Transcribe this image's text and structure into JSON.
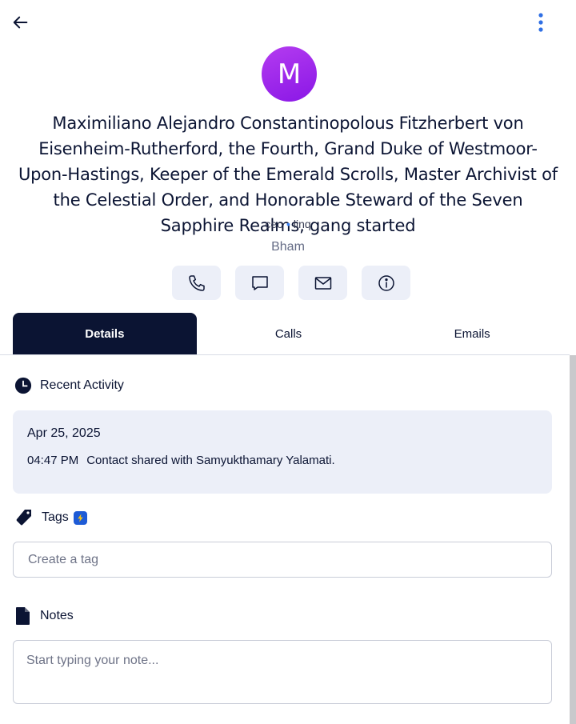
{
  "header": {
    "back_icon": "arrow-left-icon",
    "more_icon": "vertical-dots-icon",
    "avatar_initial": "M",
    "name": "Maximiliano Alejandro Constantinopolous Fitzherbert von Eisenheim-Rutherford, the Fourth, Grand Duke of Westmoor-Upon-Hastings, Keeper of the Emerald Scrolls, Master Archivist of the Celestial Order, and Honorable Steward of the Seven Sapphire Realms, gang started",
    "title": "ceo",
    "company": "linq",
    "location": "Bham"
  },
  "actions": [
    "phone-icon",
    "message-icon",
    "mail-icon",
    "info-icon"
  ],
  "tabs": [
    {
      "label": "Details",
      "active": true
    },
    {
      "label": "Calls",
      "active": false
    },
    {
      "label": "Emails",
      "active": false
    }
  ],
  "recent_activity": {
    "heading": "Recent Activity",
    "date": "Apr 25, 2025",
    "time": "04:47 PM",
    "text": "Contact shared with Samyukthamary Yalamati."
  },
  "tags": {
    "heading": "Tags",
    "placeholder": "Create a tag"
  },
  "notes": {
    "heading": "Notes",
    "placeholder": "Start typing your note..."
  },
  "colors": {
    "primary": "#0b1433",
    "accent": "#3b82f6",
    "avatar": "#9d23eb",
    "card_bg": "#eceff8"
  }
}
